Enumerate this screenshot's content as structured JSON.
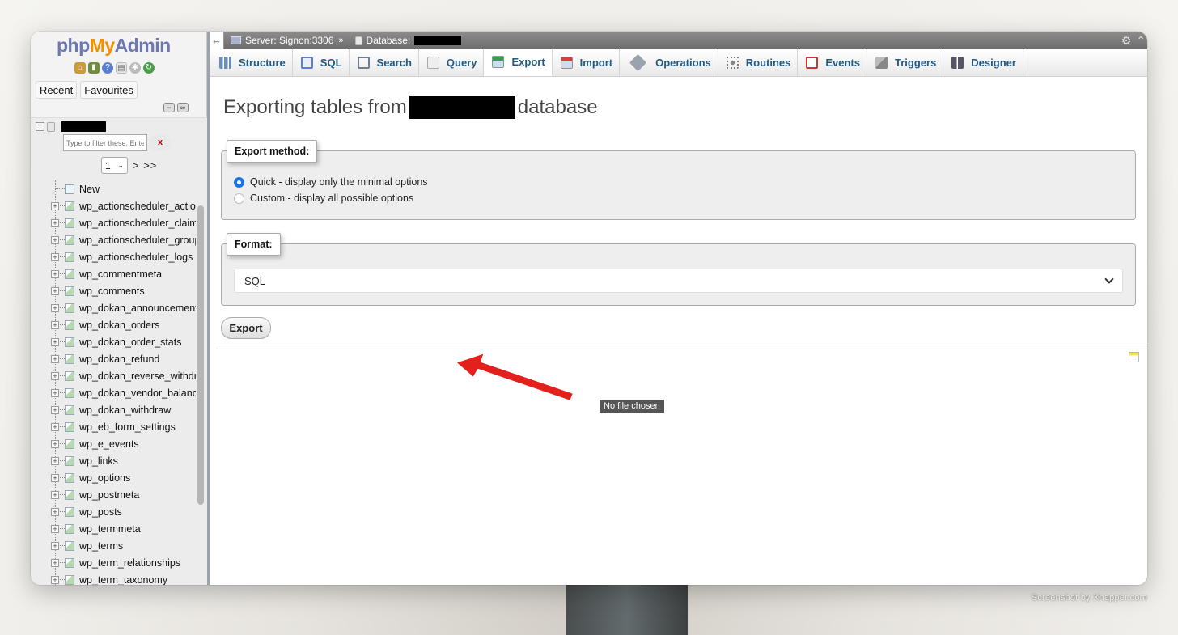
{
  "watermark": "Screenshot by Xnapper.com",
  "sidebar": {
    "logo": {
      "php": "php",
      "my": "My",
      "admin": "Admin"
    },
    "quick_icons": [
      "home-icon",
      "exit-icon",
      "help-icon",
      "docs-icon",
      "settings-icon",
      "reload-icon"
    ],
    "tabs": [
      {
        "label": "Recent"
      },
      {
        "label": "Favourites"
      }
    ],
    "filter": {
      "placeholder": "Type to filter these, Enter",
      "clear_label": "x"
    },
    "pager": {
      "page": "1",
      "next": "> >>"
    },
    "new_label": "New",
    "tables": [
      "wp_actionscheduler_actions",
      "wp_actionscheduler_claims",
      "wp_actionscheduler_groups",
      "wp_actionscheduler_logs",
      "wp_commentmeta",
      "wp_comments",
      "wp_dokan_announcement",
      "wp_dokan_orders",
      "wp_dokan_order_stats",
      "wp_dokan_refund",
      "wp_dokan_reverse_withdrawal",
      "wp_dokan_vendor_balance",
      "wp_dokan_withdraw",
      "wp_eb_form_settings",
      "wp_e_events",
      "wp_links",
      "wp_options",
      "wp_postmeta",
      "wp_posts",
      "wp_termmeta",
      "wp_terms",
      "wp_term_relationships",
      "wp_term_taxonomy"
    ]
  },
  "breadcrumb": {
    "back": "←",
    "server": "Server: Signon:3306",
    "separator": "»",
    "database": "Database:"
  },
  "tabs": [
    {
      "label": "Structure",
      "icon": "structure-icon"
    },
    {
      "label": "SQL",
      "icon": "sql-icon"
    },
    {
      "label": "Search",
      "icon": "search-icon"
    },
    {
      "label": "Query",
      "icon": "query-icon"
    },
    {
      "label": "Export",
      "icon": "export-icon",
      "active": true
    },
    {
      "label": "Import",
      "icon": "import-icon"
    },
    {
      "label": "Operations",
      "icon": "operations-icon"
    },
    {
      "label": "Routines",
      "icon": "routines-icon"
    },
    {
      "label": "Events",
      "icon": "events-icon"
    },
    {
      "label": "Triggers",
      "icon": "triggers-icon"
    },
    {
      "label": "Designer",
      "icon": "designer-icon"
    }
  ],
  "main": {
    "heading_prefix": "Exporting tables from",
    "heading_suffix": "database",
    "export_method": {
      "legend": "Export method:",
      "options": [
        {
          "label": "Quick - display only the minimal options",
          "checked": true
        },
        {
          "label": "Custom - display all possible options",
          "checked": false
        }
      ]
    },
    "format": {
      "legend": "Format:",
      "selected": "SQL"
    },
    "export_button": "Export",
    "file_tooltip": "No file chosen"
  },
  "colors": {
    "tab_text": "#235a81",
    "radio_accent": "#1a73e8",
    "annotation_arrow": "#e3211c"
  }
}
